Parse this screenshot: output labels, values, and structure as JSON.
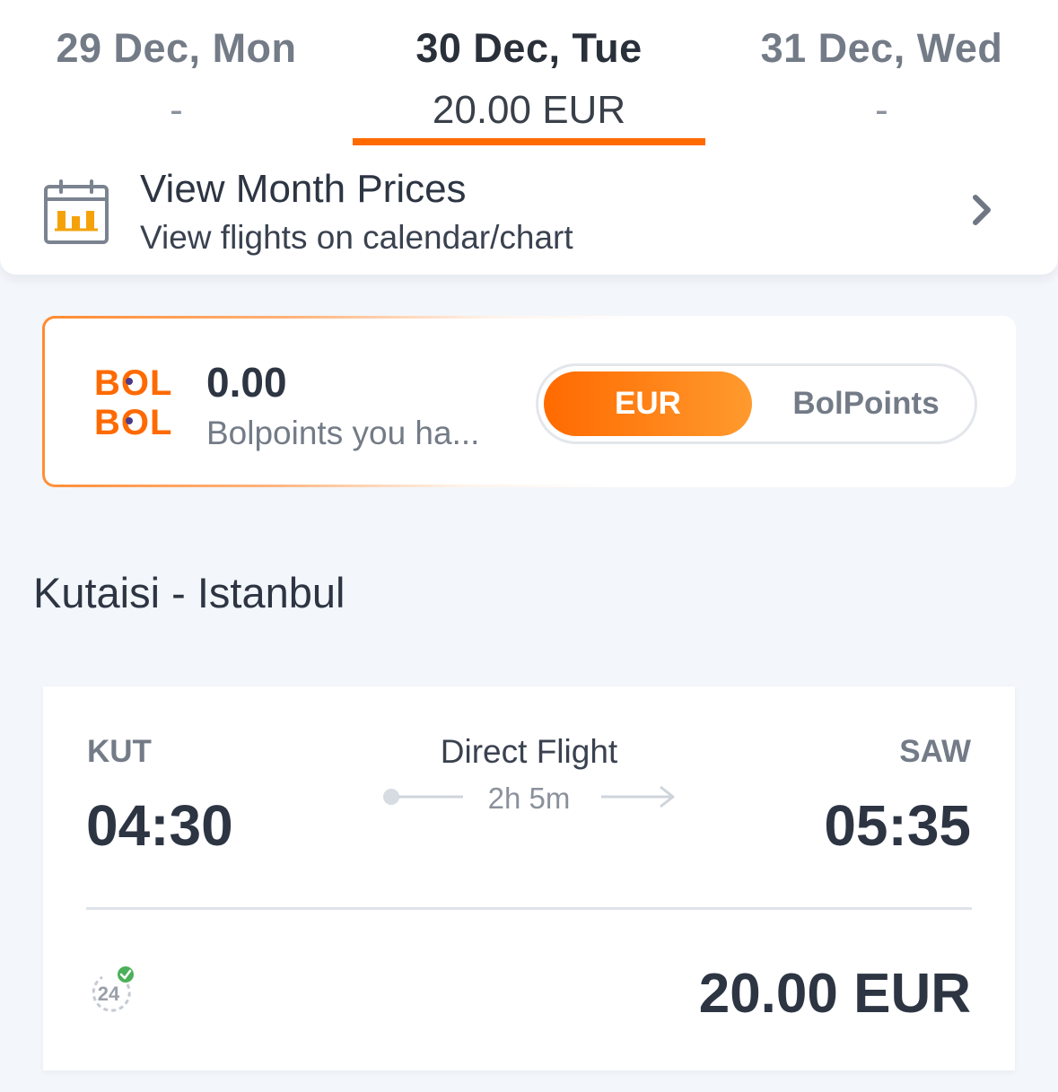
{
  "dates": [
    {
      "label": "29 Dec, Mon",
      "price": "-",
      "active": false
    },
    {
      "label": "30 Dec, Tue",
      "price": "20.00 EUR",
      "active": true
    },
    {
      "label": "31 Dec, Wed",
      "price": "-",
      "active": false
    }
  ],
  "month_prices": {
    "title": "View Month Prices",
    "subtitle": "View flights on calendar/chart",
    "icon": "calendar-chart-icon"
  },
  "bolpoints": {
    "logo_text": [
      "BOL",
      "BOL"
    ],
    "value": "0.00",
    "subtitle": "Bolpoints you ha...",
    "toggle": {
      "active": "EUR",
      "inactive": "BolPoints"
    }
  },
  "route_title": "Kutaisi - Istanbul",
  "flight": {
    "departure_code": "KUT",
    "arrival_code": "SAW",
    "departure_time": "04:30",
    "arrival_time": "05:35",
    "type": "Direct Flight",
    "duration": "2h 5m",
    "badge_text": "24",
    "price": "20.00 EUR"
  },
  "colors": {
    "accent": "#ff6a00",
    "text_dark": "#2d3543",
    "text_muted": "#737b87",
    "background": "#f3f6fa",
    "check_green": "#4cb05a"
  }
}
